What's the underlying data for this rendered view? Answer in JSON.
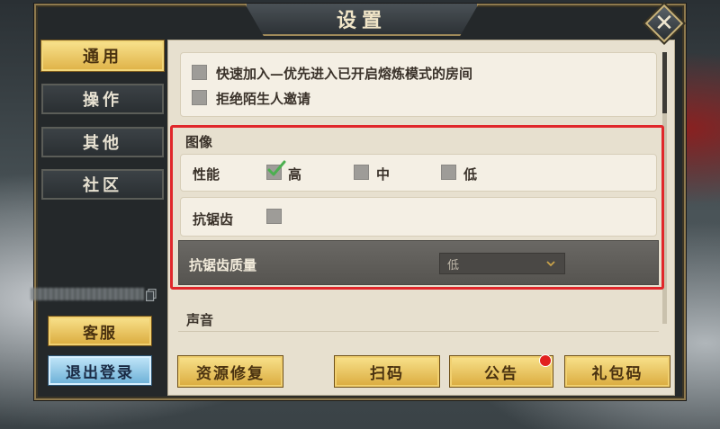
{
  "dialog": {
    "title": "设置"
  },
  "nav": {
    "items": [
      {
        "label": "通用",
        "active": true
      },
      {
        "label": "操作",
        "active": false
      },
      {
        "label": "其他",
        "active": false
      },
      {
        "label": "社区",
        "active": false
      }
    ]
  },
  "side_actions": {
    "customer_service": "客服",
    "logout": "退出登录"
  },
  "general": {
    "quick_join": {
      "label": "快速加入—优先进入已开启熔炼模式的房间",
      "checked": false
    },
    "reject_strangers": {
      "label": "拒绝陌生人邀请",
      "checked": false
    }
  },
  "image": {
    "section_title": "图像",
    "performance": {
      "label": "性能",
      "options": [
        {
          "label": "高",
          "checked": true
        },
        {
          "label": "中",
          "checked": false
        },
        {
          "label": "低",
          "checked": false
        }
      ]
    },
    "anti_aliasing": {
      "label": "抗锯齿",
      "checked": false
    },
    "aa_quality": {
      "label": "抗锯齿质量",
      "value": "低"
    }
  },
  "sound": {
    "section_title": "声音"
  },
  "bottom_buttons": {
    "repair": "资源修复",
    "scan": "扫码",
    "notice": "公告",
    "gift_code": "礼包码"
  },
  "colors": {
    "accent_gold": "#e0b44a",
    "highlight_red": "#e0272b",
    "check_green": "#4caf50"
  }
}
